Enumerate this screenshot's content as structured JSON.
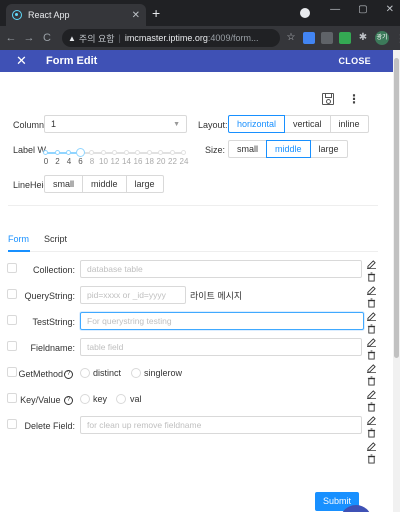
{
  "browser": {
    "tab_title": "React App",
    "tab_close": "✕",
    "new_tab": "+",
    "back": "←",
    "forward": "→",
    "reload": "C",
    "security_label": "주의 요함",
    "url_host": "imcmaster.iptime.org",
    "url_path": ":4009/form...",
    "window_minimize": "—",
    "window_restore": "▢",
    "window_close": "✕",
    "avatar_label": "광기",
    "menu": "⋮"
  },
  "appbar": {
    "title": "Form Edit",
    "close_label": "CLOSE"
  },
  "settings": {
    "column_label": "Column",
    "column_value": "1",
    "layout_label": "Layout:",
    "layout_options": [
      "horizontal",
      "vertical",
      "inline"
    ],
    "layout_selected": "horizontal",
    "label_width_label": "Label W",
    "label_width_marks": [
      "0",
      "2",
      "4",
      "6",
      "8",
      "10",
      "12",
      "14",
      "16",
      "18",
      "20",
      "22",
      "24"
    ],
    "label_width_value": 6,
    "size_label": "Size:",
    "size_options": [
      "small",
      "middle",
      "large"
    ],
    "size_selected": "middle",
    "line_height_label": "LineHeig",
    "line_height_options": [
      "small",
      "middle",
      "large"
    ]
  },
  "tabs": {
    "form": "Form",
    "script": "Script",
    "active": "Form"
  },
  "fields": [
    {
      "label": "Collection:",
      "placeholder": "database table"
    },
    {
      "label": "QueryString:",
      "placeholder": "pid=xxxx or _id=yyyy",
      "side_text": "라이트 메시지"
    },
    {
      "label": "TestString:",
      "placeholder": "For querystring testing"
    },
    {
      "label": "Fieldname:",
      "placeholder": "table field"
    },
    {
      "label": "GetMethod",
      "options": [
        "distinct",
        "singlerow"
      ]
    },
    {
      "label": "Key/Value",
      "options": [
        "key",
        "val"
      ]
    },
    {
      "label": "Delete Field:",
      "placeholder": "for clean up remove fieldname"
    }
  ],
  "submit_label": "Submit",
  "colors": {
    "appbar": "#3f51b5",
    "primary": "#1890ff"
  }
}
